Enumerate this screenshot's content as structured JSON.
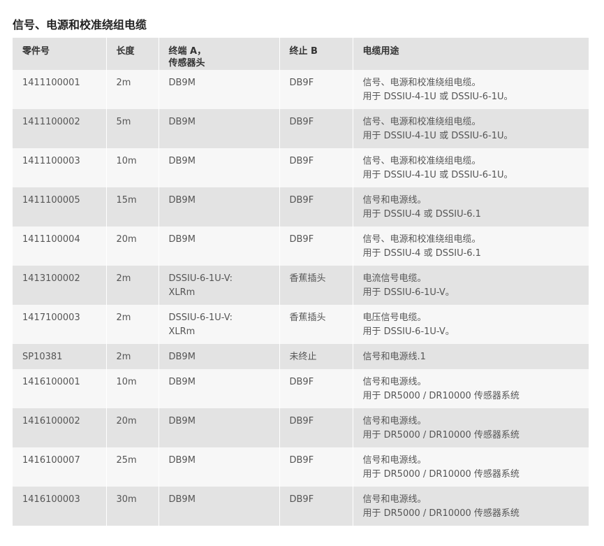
{
  "page": {
    "title": "信号、电源和校准绕组电缆"
  },
  "table": {
    "headers": [
      {
        "line1": "零件号",
        "line2": ""
      },
      {
        "line1": "长度",
        "line2": ""
      },
      {
        "line1": "终端 A，",
        "line2": "传感器头"
      },
      {
        "line1": "终止 B",
        "line2": ""
      },
      {
        "line1": "电缆用途",
        "line2": ""
      }
    ],
    "rows": [
      {
        "part": "1411100001",
        "length": "2m",
        "end_a": {
          "line1": "DB9M",
          "line2": ""
        },
        "end_b": "DB9F",
        "usage": {
          "line1": "信号、电源和校准绕组电缆。",
          "line2": "用于 DSSIU-4-1U 或 DSSIU-6-1U。"
        }
      },
      {
        "part": "1411100002",
        "length": "5m",
        "end_a": {
          "line1": "DB9M",
          "line2": ""
        },
        "end_b": "DB9F",
        "usage": {
          "line1": "信号、电源和校准绕组电缆。",
          "line2": "用于 DSSIU-4-1U 或 DSSIU-6-1U。"
        }
      },
      {
        "part": "1411100003",
        "length": "10m",
        "end_a": {
          "line1": "DB9M",
          "line2": ""
        },
        "end_b": "DB9F",
        "usage": {
          "line1": "信号、电源和校准绕组电缆。",
          "line2": "用于 DSSIU-4-1U 或 DSSIU-6-1U。"
        }
      },
      {
        "part": "1411100005",
        "length": "15m",
        "end_a": {
          "line1": "DB9M",
          "line2": ""
        },
        "end_b": "DB9F",
        "usage": {
          "line1": "信号和电源线。",
          "line2": "用于 DSSIU-4 或 DSSIU-6.1"
        }
      },
      {
        "part": "1411100004",
        "length": "20m",
        "end_a": {
          "line1": "DB9M",
          "line2": ""
        },
        "end_b": "DB9F",
        "usage": {
          "line1": "信号、电源和校准绕组电缆。",
          "line2": "用于 DSSIU-4 或 DSSIU-6.1"
        }
      },
      {
        "part": "1413100002",
        "length": "2m",
        "end_a": {
          "line1": "DSSIU-6-1U-V:",
          "line2": "XLRm"
        },
        "end_b": "香蕉插头",
        "usage": {
          "line1": "电流信号电缆。",
          "line2": "用于 DSSIU-6-1U-V。"
        }
      },
      {
        "part": "1417100003",
        "length": "2m",
        "end_a": {
          "line1": "DSSIU-6-1U-V:",
          "line2": "XLRm"
        },
        "end_b": "香蕉插头",
        "usage": {
          "line1": "电压信号电缆。",
          "line2": "用于 DSSIU-6-1U-V。"
        }
      },
      {
        "part": "SP10381",
        "length": "2m",
        "end_a": {
          "line1": "DB9M",
          "line2": ""
        },
        "end_b": "未终止",
        "usage": {
          "line1": "信号和电源线.1",
          "line2": ""
        }
      },
      {
        "part": "1416100001",
        "length": "10m",
        "end_a": {
          "line1": "DB9M",
          "line2": ""
        },
        "end_b": "DB9F",
        "usage": {
          "line1": "信号和电源线。",
          "line2": "用于 DR5000 / DR10000 传感器系统"
        }
      },
      {
        "part": "1416100002",
        "length": "20m",
        "end_a": {
          "line1": "DB9M",
          "line2": ""
        },
        "end_b": "DB9F",
        "usage": {
          "line1": "信号和电源线。",
          "line2": "用于 DR5000 / DR10000 传感器系统"
        }
      },
      {
        "part": "1416100007",
        "length": "25m",
        "end_a": {
          "line1": "DB9M",
          "line2": ""
        },
        "end_b": "DB9F",
        "usage": {
          "line1": "信号和电源线。",
          "line2": "用于 DR5000 / DR10000 传感器系统"
        }
      },
      {
        "part": "1416100003",
        "length": "30m",
        "end_a": {
          "line1": "DB9M",
          "line2": ""
        },
        "end_b": "DB9F",
        "usage": {
          "line1": "信号和电源线。",
          "line2": "用于 DR5000 / DR10000 传感器系统"
        }
      }
    ]
  }
}
